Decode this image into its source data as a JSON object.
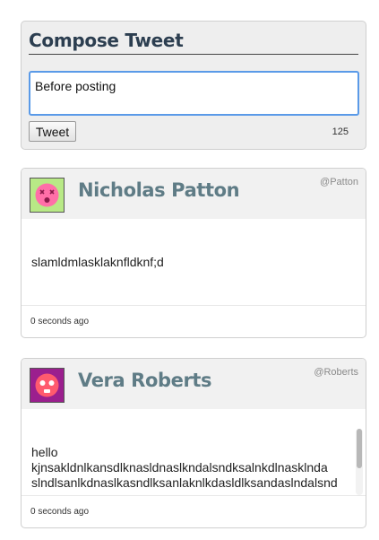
{
  "compose": {
    "title": "Compose Tweet",
    "input_value": "Before posting",
    "button_label": "Tweet",
    "chars_remaining": "125",
    "accent_color": "#5a9ae8"
  },
  "tweets": [
    {
      "author": "Nicholas Patton",
      "handle": "@Patton",
      "text": "slamldmlasklaknfldknf;d",
      "timestamp": "0 seconds ago",
      "avatar_icon": "dizzy-face-icon",
      "avatar_colors": {
        "bg": "#b8e986",
        "face": "#ff6fa8"
      }
    },
    {
      "author": "Vera Roberts",
      "handle": "@Roberts",
      "text_lines": [
        "hello",
        "kjnsakldnlkansdlknasldnaslkndalsndksalnkdlnasklnda",
        "slndlsanlkdnaslkasndlksanlaknlkdasldlksandaslndalsnd"
      ],
      "timestamp": "0 seconds ago",
      "avatar_icon": "robot-face-icon",
      "avatar_colors": {
        "bg": "#9b1f8e",
        "face": "#ff5a6e"
      }
    }
  ]
}
